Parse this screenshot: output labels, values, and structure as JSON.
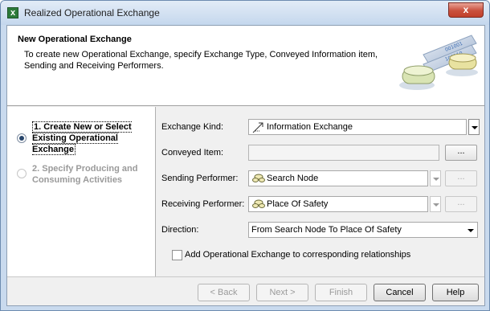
{
  "window": {
    "title": "Realized Operational Exchange",
    "app_icon": "x-app-icon",
    "close_label": "x"
  },
  "header": {
    "title": "New Operational Exchange",
    "description": "To create new Operational Exchange, specify Exchange Type, Conveyed Information item, Sending and Receiving Performers.",
    "art_icon": "database-exchange-icon"
  },
  "steps": [
    {
      "label": "1. Create New or Select Existing Operational Exchange",
      "selected": true,
      "enabled": true
    },
    {
      "label": "2. Specify Producing and Consuming Activities",
      "selected": false,
      "enabled": false
    }
  ],
  "form": {
    "exchange_kind": {
      "label": "Exchange Kind:",
      "value": "Information Exchange",
      "icon": "information-exchange-icon"
    },
    "conveyed_item": {
      "label": "Conveyed Item:",
      "value": "",
      "button": "..."
    },
    "sending_performer": {
      "label": "Sending Performer:",
      "value": "Search Node",
      "icon": "node-icon",
      "button": "..."
    },
    "receiving_performer": {
      "label": "Receiving Performer:",
      "value": "Place Of Safety",
      "icon": "node-icon",
      "button": "..."
    },
    "direction": {
      "label": "Direction:",
      "value": "From Search Node To Place Of Safety"
    },
    "add_relationships": {
      "label": "Add Operational Exchange to corresponding relationships",
      "checked": false
    }
  },
  "buttons": {
    "back": "< Back",
    "next": "Next >",
    "finish": "Finish",
    "cancel": "Cancel",
    "help": "Help"
  },
  "colors": {
    "title_bar": "#c4d7ed",
    "close_button": "#c9503d",
    "selected_radio": "#27456b"
  }
}
